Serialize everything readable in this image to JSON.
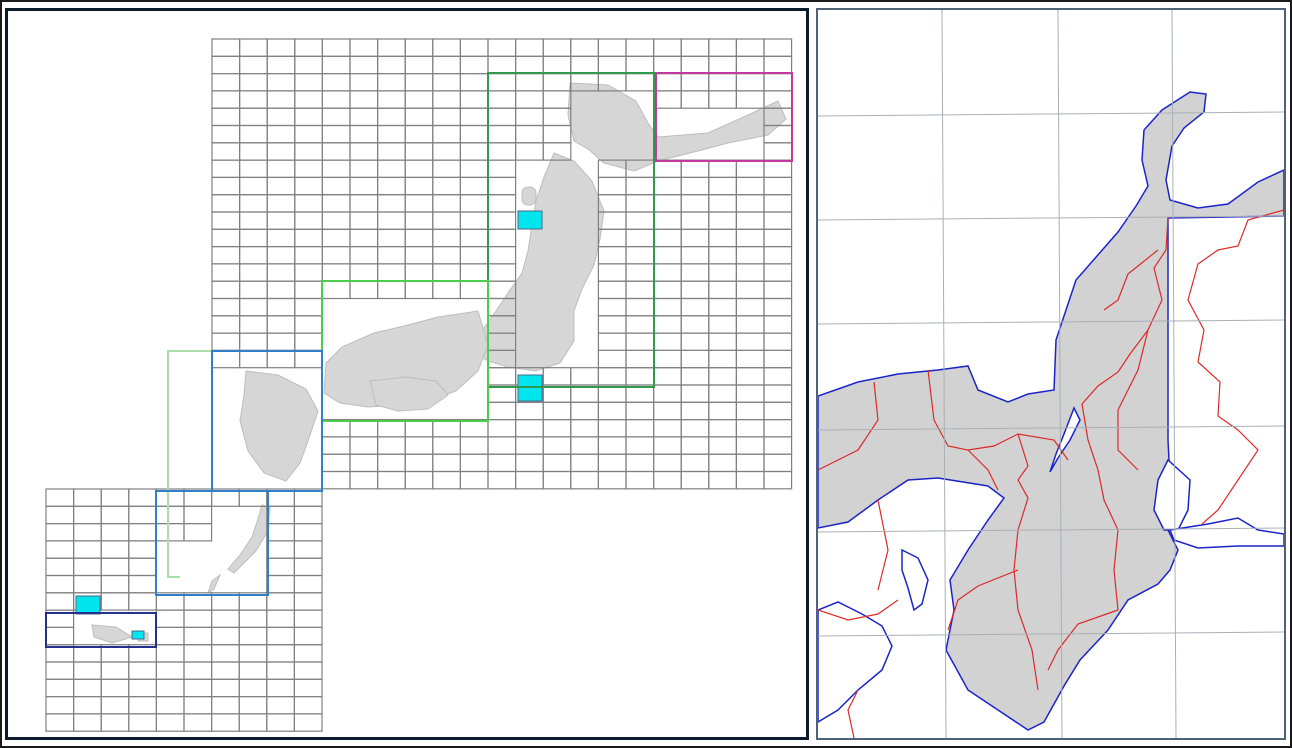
{
  "colors": {
    "grid_line": "#808080",
    "frame_dark": "#0d1a2e",
    "frame_right": "#50627a",
    "terrain": "#d4d4d4",
    "terrain_dark": "#b8b8b8",
    "highlight_cyan": "#00e5ee",
    "coast_blue": "#1c24c8",
    "boundary_red": "#dc2a2a",
    "graticule": "#a8b0b8",
    "region_magenta": "#c2389c",
    "region_green_dark": "#2f9a4a",
    "region_green_light": "#4ccc4c",
    "region_green_pale": "#a8e0a8",
    "region_blue": "#2f80c8",
    "region_navy": "#23308c"
  },
  "panels": {
    "left": {
      "description_icon": "japan-index-grid-map"
    },
    "right": {
      "description_icon": "kinki-chubu-relief-map"
    }
  }
}
